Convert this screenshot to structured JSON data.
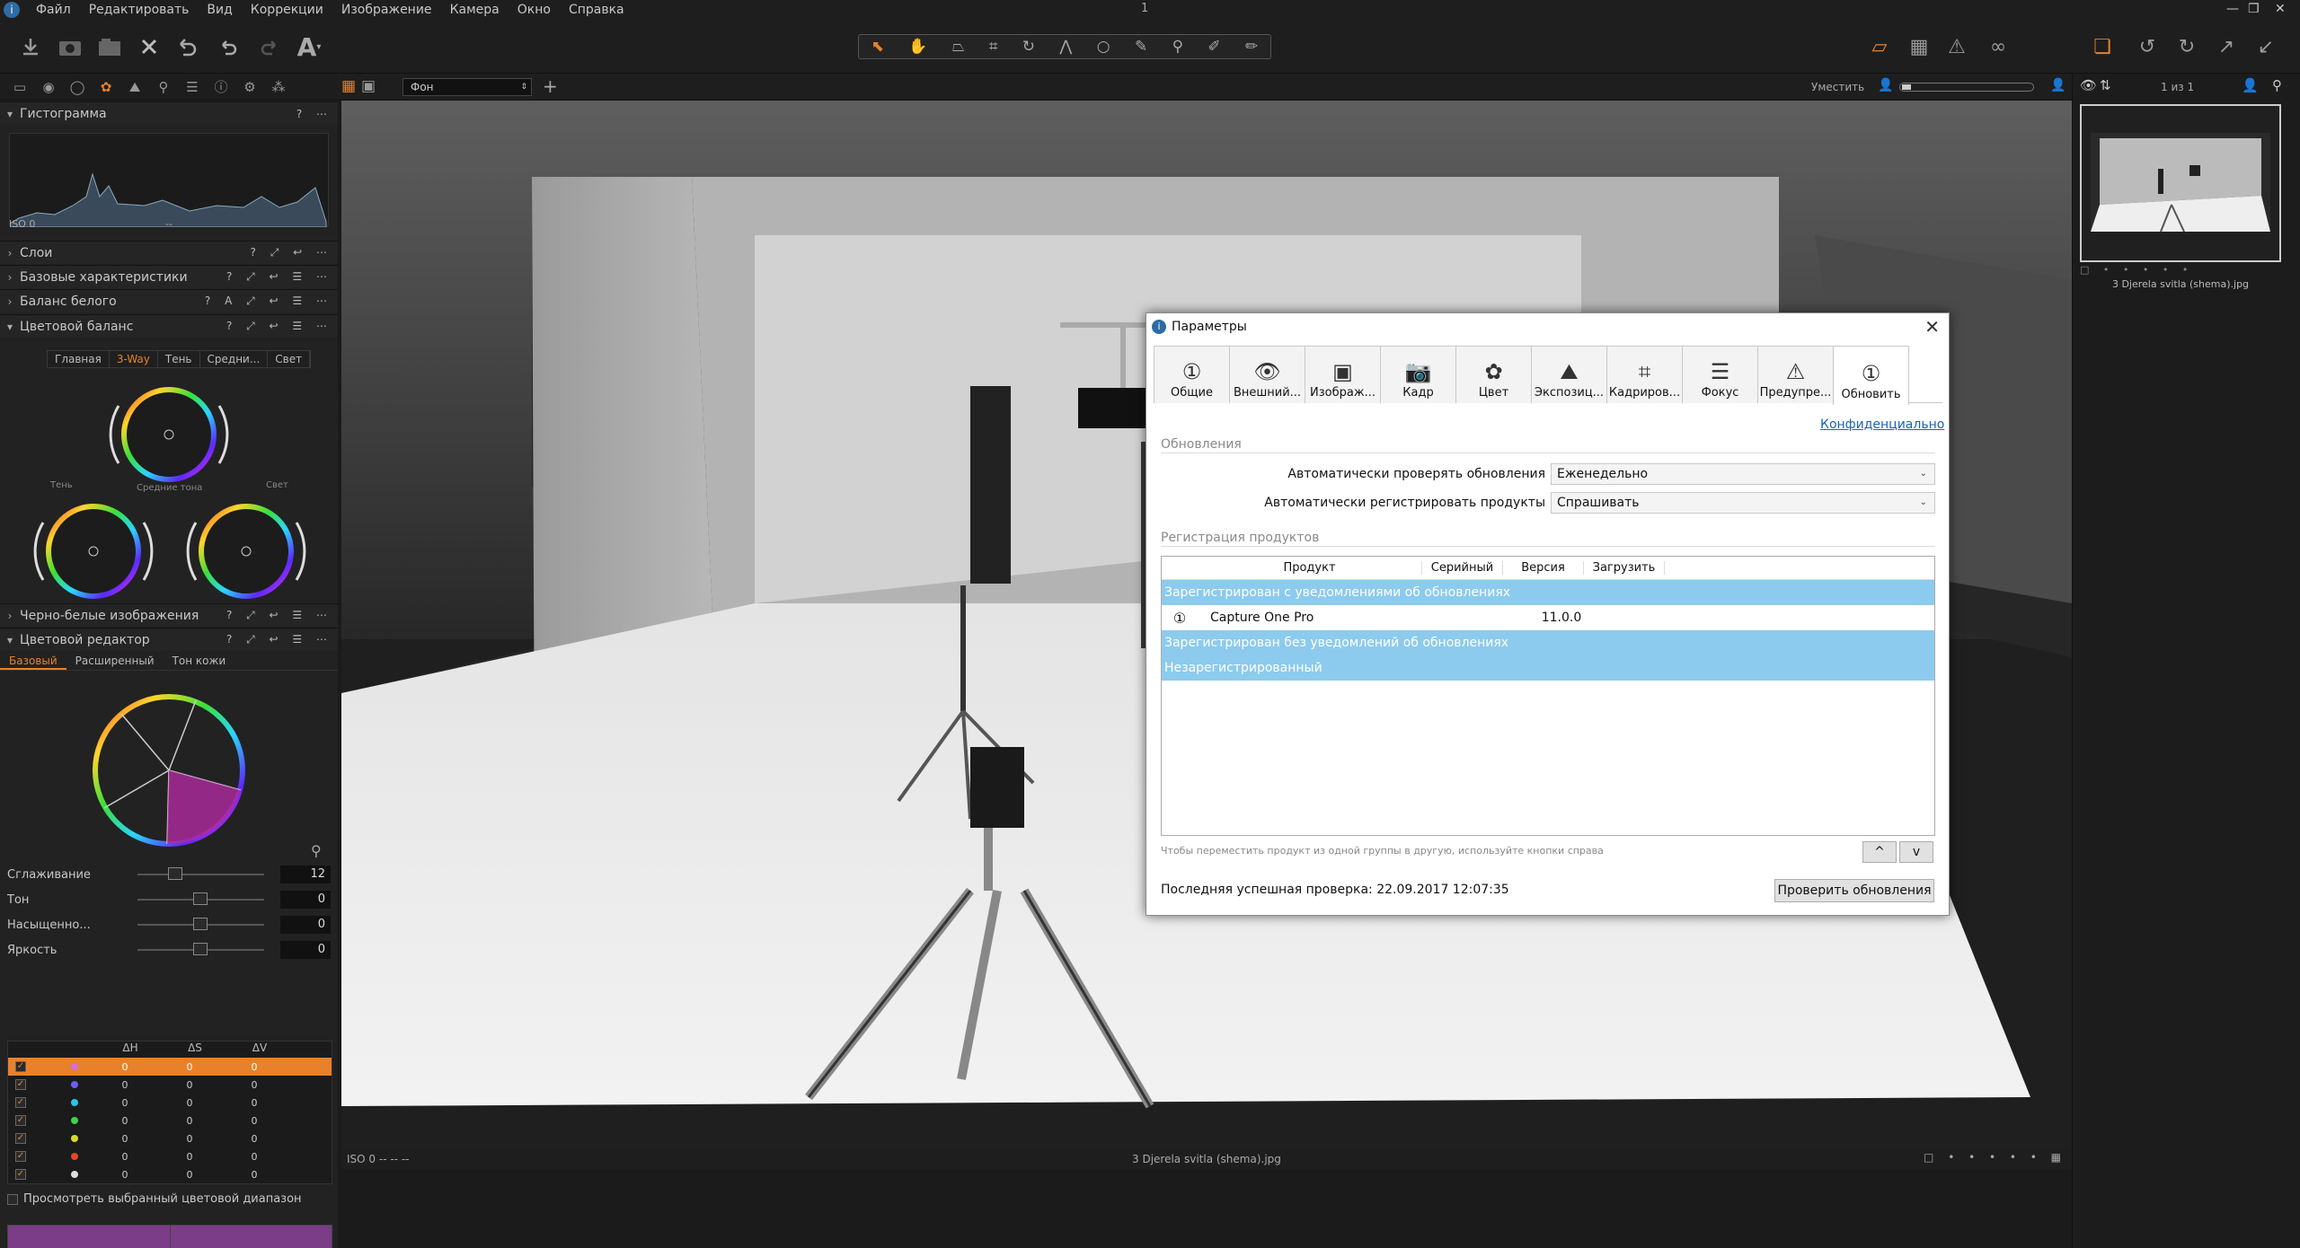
{
  "menubar": {
    "items": [
      "Файл",
      "Редактировать",
      "Вид",
      "Коррекции",
      "Изображение",
      "Камера",
      "Окно",
      "Справка"
    ],
    "window_title": "1"
  },
  "viewer_header": {
    "layer_select": "Фон",
    "fit_label": "Уместить",
    "counter": "1 из 1"
  },
  "panels": {
    "histogram": {
      "title": "Гистограмма",
      "footer_left": "ISO 0",
      "footer_mid": "--"
    },
    "layers": {
      "title": "Слои"
    },
    "basic": {
      "title": "Базовые характеристики"
    },
    "white_balance": {
      "title": "Баланс белого"
    },
    "color_balance": {
      "title": "Цветовой баланс",
      "tabs": [
        "Главная",
        "3-Way",
        "Тень",
        "Средни...",
        "Свет"
      ],
      "wheel_shadow": "Тень",
      "wheel_mid": "Средние тона",
      "wheel_light": "Свет"
    },
    "bw": {
      "title": "Черно-белые изображения"
    },
    "color_editor": {
      "title": "Цветовой редактор",
      "tabs": [
        "Базовый",
        "Расширенный",
        "Тон кожи"
      ],
      "sliders": [
        {
          "label": "Сглаживание",
          "value": "12",
          "pos": 0.3
        },
        {
          "label": "Тон",
          "value": "0",
          "pos": 0.5
        },
        {
          "label": "Насыщенно...",
          "value": "0",
          "pos": 0.5
        },
        {
          "label": "Яркость",
          "value": "0",
          "pos": 0.5
        }
      ],
      "table": {
        "headers": [
          "ΔH",
          "ΔS",
          "ΔV"
        ],
        "rows": [
          {
            "color": "#d66de0",
            "h": "0",
            "s": "0",
            "v": "0"
          },
          {
            "color": "#6a5cff",
            "h": "0",
            "s": "0",
            "v": "0"
          },
          {
            "color": "#2bc3e8",
            "h": "0",
            "s": "0",
            "v": "0"
          },
          {
            "color": "#43d04a",
            "h": "0",
            "s": "0",
            "v": "0"
          },
          {
            "color": "#d8d82c",
            "h": "0",
            "s": "0",
            "v": "0"
          },
          {
            "color": "#e8452a",
            "h": "0",
            "s": "0",
            "v": "0"
          },
          {
            "color": "#dddddd",
            "h": "0",
            "s": "0",
            "v": "0"
          }
        ]
      },
      "view_range": "Просмотреть выбранный цветовой диапазон"
    }
  },
  "viewer_footer": {
    "left": "ISO 0 -- -- --",
    "filename": "3 Djerela svitla (shema).jpg"
  },
  "browser": {
    "thumb_name": "3 Djerela svitla (shema).jpg"
  },
  "dialog": {
    "title": "Параметры",
    "tabs": [
      {
        "label": "Общие",
        "icon": "①"
      },
      {
        "label": "Внешний...",
        "icon": "👁"
      },
      {
        "label": "Изображ...",
        "icon": "▣"
      },
      {
        "label": "Кадр",
        "icon": "📷"
      },
      {
        "label": "Цвет",
        "icon": "✿"
      },
      {
        "label": "Экспозиц...",
        "icon": "⛰"
      },
      {
        "label": "Кадриров...",
        "icon": "⌗"
      },
      {
        "label": "Фокус",
        "icon": "☰"
      },
      {
        "label": "Предупре...",
        "icon": "⚠"
      },
      {
        "label": "Обновить",
        "icon": "①"
      }
    ],
    "privacy_link": "Конфиденциально",
    "updates_section": "Обновления",
    "auto_check_label": "Автоматически проверять обновления",
    "auto_check_value": "Еженедельно",
    "auto_register_label": "Автоматически регистрировать продукты",
    "auto_register_value": "Спрашивать",
    "registration_section": "Регистрация продуктов",
    "columns": [
      "Продукт",
      "Серийный",
      "Версия",
      "Загрузить"
    ],
    "group_notify": "Зарегистрирован с уведомлениями об обновлениях",
    "product_name": "Capture One Pro",
    "product_version": "11.0.0",
    "group_no_notify": "Зарегистрирован без уведомлений об обновлениях",
    "group_unreg": "Незарегистрированный",
    "hint": "Чтобы переместить продукт из одной группы в другую, используйте кнопки справа",
    "up": "^",
    "down": "v",
    "last_check": "Последняя успешная проверка: 22.09.2017 12:07:35",
    "check_button": "Проверить обновления"
  }
}
